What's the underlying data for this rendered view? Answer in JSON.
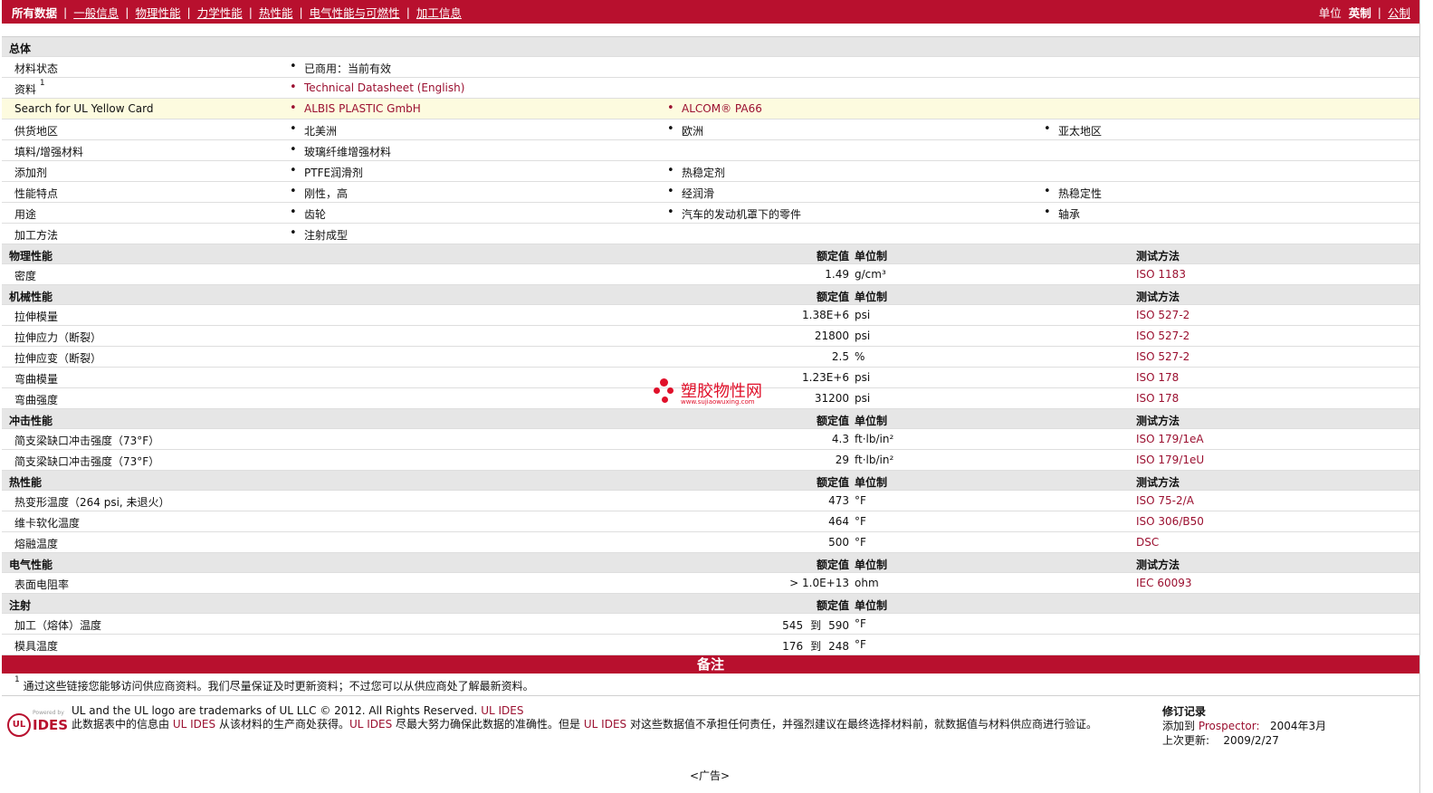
{
  "nav": {
    "items": [
      "所有数据",
      "一般信息",
      "物理性能",
      "力学性能",
      "热性能",
      "电气性能与可燃性",
      "加工信息"
    ],
    "units_label": "单位",
    "units_imperial": "英制",
    "units_metric": "公制"
  },
  "general": {
    "title": "总体",
    "material_status": {
      "label": "材料状态",
      "values": [
        "已商用：当前有效"
      ]
    },
    "documents": {
      "label": "资料",
      "sup": "1",
      "values": [
        "Technical Datasheet (English)"
      ]
    },
    "ul_yellow": {
      "label": "Search for UL Yellow Card",
      "values": [
        "ALBIS PLASTIC GmbH",
        "ALCOM® PA66"
      ]
    },
    "availability": {
      "label": "供货地区",
      "values": [
        "北美洲",
        "欧洲",
        "亚太地区"
      ]
    },
    "filler": {
      "label": "填料/增强材料",
      "values": [
        "玻璃纤维增强材料"
      ]
    },
    "additive": {
      "label": "添加剂",
      "values": [
        "PTFE润滑剂",
        "热稳定剂"
      ]
    },
    "features": {
      "label": "性能特点",
      "values": [
        "刚性，高",
        "经润滑",
        "热稳定性"
      ]
    },
    "uses": {
      "label": "用途",
      "values": [
        "齿轮",
        "汽车的发动机罩下的零件",
        "轴承"
      ]
    },
    "processing": {
      "label": "加工方法",
      "values": [
        "注射成型"
      ]
    }
  },
  "headers": {
    "nominal": "额定值",
    "unit": "单位制",
    "test": "测试方法"
  },
  "physical": {
    "title": "物理性能",
    "rows": [
      {
        "label": "密度",
        "value": "1.49",
        "unit": "g/cm³",
        "test": "ISO 1183"
      }
    ]
  },
  "mechanical": {
    "title": "机械性能",
    "rows": [
      {
        "label": "拉伸模量",
        "value": "1.38E+6",
        "unit": "psi",
        "test": "ISO 527-2"
      },
      {
        "label": "拉伸应力（断裂）",
        "value": "21800",
        "unit": "psi",
        "test": "ISO 527-2"
      },
      {
        "label": "拉伸应变（断裂）",
        "value": "2.5",
        "unit": "%",
        "test": "ISO 527-2"
      },
      {
        "label": "弯曲模量",
        "value": "1.23E+6",
        "unit": "psi",
        "test": "ISO 178"
      },
      {
        "label": "弯曲强度",
        "value": "31200",
        "unit": "psi",
        "test": "ISO 178"
      }
    ]
  },
  "impact": {
    "title": "冲击性能",
    "rows": [
      {
        "label": "简支梁缺口冲击强度（73°F）",
        "value": "4.3",
        "unit": "ft·lb/in²",
        "test": "ISO 179/1eA"
      },
      {
        "label": "简支梁缺口冲击强度（73°F）",
        "value": "29",
        "unit": "ft·lb/in²",
        "test": "ISO 179/1eU"
      }
    ]
  },
  "thermal": {
    "title": "热性能",
    "rows": [
      {
        "label": "热变形温度（264 psi, 未退火）",
        "value": "473",
        "unit": "°F",
        "test": "ISO 75-2/A"
      },
      {
        "label": "维卡软化温度",
        "value": "464",
        "unit": "°F",
        "test": "ISO 306/B50"
      },
      {
        "label": "熔融温度",
        "value": "500",
        "unit": "°F",
        "test": "DSC"
      }
    ]
  },
  "electrical": {
    "title": "电气性能",
    "rows": [
      {
        "label": "表面电阻率",
        "value": "> 1.0E+13",
        "unit": "ohm",
        "test": "IEC 60093"
      }
    ]
  },
  "injection": {
    "title": "注射",
    "rows": [
      {
        "label": "加工（熔体）温度",
        "min": "545",
        "to": "到",
        "max": "590",
        "unit": "°F"
      },
      {
        "label": "模具温度",
        "min": "176",
        "to": "到",
        "max": "248",
        "unit": "°F"
      }
    ]
  },
  "notes": {
    "title": "备注",
    "items": [
      {
        "sup": "1",
        "text": "通过这些链接您能够访问供应商资料。我们尽量保证及时更新资料；不过您可以从供应商处了解最新资料。"
      }
    ]
  },
  "footer": {
    "logo_powered": "Powered by",
    "logo_ul": "UL",
    "logo_ides": "IDES",
    "line1_text": "UL and the UL logo are trademarks of UL LLC © 2012. All Rights Reserved.",
    "line1_link": "UL IDES",
    "line2_a": "此数据表中的信息由",
    "line2_link1": "UL IDES",
    "line2_b": "从该材料的生产商处获得。",
    "line2_link2": "UL IDES",
    "line2_c": "尽最大努力确保此数据的准确性。但是",
    "line2_link3": "UL IDES",
    "line2_d": "对这些数据值不承担任何责任，并强烈建议在最终选择材料前，就数据值与材料供应商进行验证。",
    "rev_title": "修订记录",
    "rev_added": "添加到",
    "rev_prospector": "Prospector:",
    "rev_added_date": "2004年3月",
    "rev_updated": "上次更新:",
    "rev_updated_date": "2009/2/27"
  },
  "ad": "<广告>",
  "watermark": {
    "cn": "塑胶物性网",
    "url": "www.sujiaowuxing.com"
  },
  "colors": {
    "brand": "#b8102e",
    "link": "#9b1030",
    "section_bg": "#e6e6e6",
    "highlight_bg": "#fdfbdf"
  }
}
